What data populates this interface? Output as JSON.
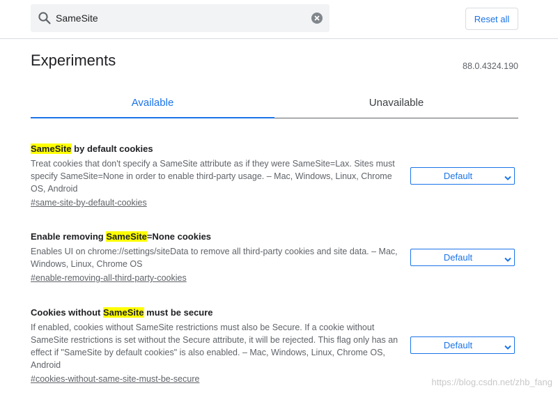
{
  "search": {
    "value": "SameSite",
    "icon": "search-icon",
    "clear_icon": "clear-icon"
  },
  "toolbar": {
    "reset_label": "Reset all"
  },
  "page": {
    "title": "Experiments",
    "version": "88.0.4324.190"
  },
  "tabs": [
    {
      "label": "Available",
      "active": true
    },
    {
      "label": "Unavailable",
      "active": false
    }
  ],
  "experiments": [
    {
      "title_before": "",
      "title_highlight": "SameSite",
      "title_after": " by default cookies",
      "description": "Treat cookies that don't specify a SameSite attribute as if they were SameSite=Lax. Sites must specify SameSite=None in order to enable third-party usage. – Mac, Windows, Linux, Chrome OS, Android",
      "link": "#same-site-by-default-cookies",
      "select_value": "Default"
    },
    {
      "title_before": "Enable removing ",
      "title_highlight": "SameSite",
      "title_after": "=None cookies",
      "description": "Enables UI on chrome://settings/siteData to remove all third-party cookies and site data. – Mac, Windows, Linux, Chrome OS",
      "link": "#enable-removing-all-third-party-cookies",
      "select_value": "Default"
    },
    {
      "title_before": "Cookies without ",
      "title_highlight": "SameSite",
      "title_after": " must be secure",
      "description": "If enabled, cookies without SameSite restrictions must also be Secure. If a cookie without SameSite restrictions is set without the Secure attribute, it will be rejected. This flag only has an effect if \"SameSite by default cookies\" is also enabled. – Mac, Windows, Linux, Chrome OS, Android",
      "link": "#cookies-without-same-site-must-be-secure",
      "select_value": "Default"
    }
  ],
  "watermark": "https://blog.csdn.net/zhb_fang",
  "colors": {
    "accent": "#1a73e8",
    "highlight": "#ffff00",
    "text_secondary": "#5f6368"
  }
}
